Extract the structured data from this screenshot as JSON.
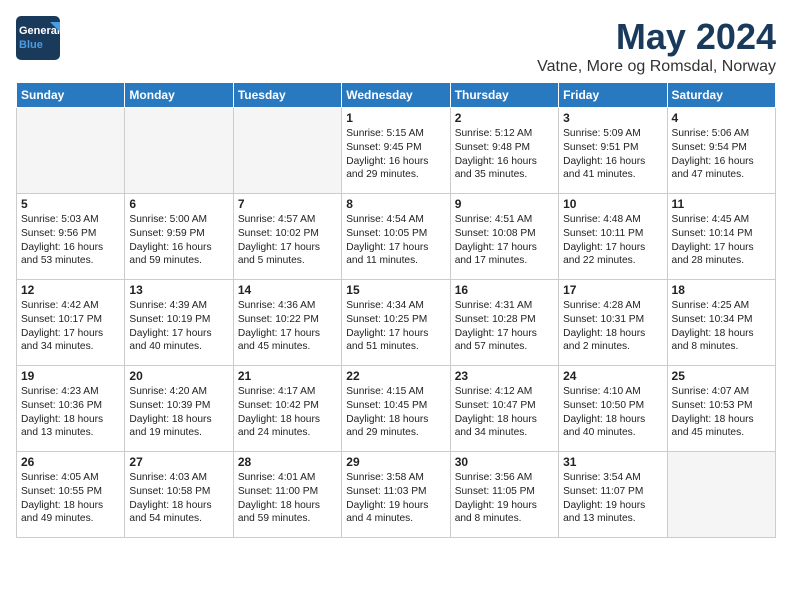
{
  "logo": {
    "line1": "General",
    "line2": "Blue"
  },
  "title": "May 2024",
  "location": "Vatne, More og Romsdal, Norway",
  "headers": [
    "Sunday",
    "Monday",
    "Tuesday",
    "Wednesday",
    "Thursday",
    "Friday",
    "Saturday"
  ],
  "weeks": [
    [
      {
        "day": "",
        "content": ""
      },
      {
        "day": "",
        "content": ""
      },
      {
        "day": "",
        "content": ""
      },
      {
        "day": "1",
        "content": "Sunrise: 5:15 AM\nSunset: 9:45 PM\nDaylight: 16 hours\nand 29 minutes."
      },
      {
        "day": "2",
        "content": "Sunrise: 5:12 AM\nSunset: 9:48 PM\nDaylight: 16 hours\nand 35 minutes."
      },
      {
        "day": "3",
        "content": "Sunrise: 5:09 AM\nSunset: 9:51 PM\nDaylight: 16 hours\nand 41 minutes."
      },
      {
        "day": "4",
        "content": "Sunrise: 5:06 AM\nSunset: 9:54 PM\nDaylight: 16 hours\nand 47 minutes."
      }
    ],
    [
      {
        "day": "5",
        "content": "Sunrise: 5:03 AM\nSunset: 9:56 PM\nDaylight: 16 hours\nand 53 minutes."
      },
      {
        "day": "6",
        "content": "Sunrise: 5:00 AM\nSunset: 9:59 PM\nDaylight: 16 hours\nand 59 minutes."
      },
      {
        "day": "7",
        "content": "Sunrise: 4:57 AM\nSunset: 10:02 PM\nDaylight: 17 hours\nand 5 minutes."
      },
      {
        "day": "8",
        "content": "Sunrise: 4:54 AM\nSunset: 10:05 PM\nDaylight: 17 hours\nand 11 minutes."
      },
      {
        "day": "9",
        "content": "Sunrise: 4:51 AM\nSunset: 10:08 PM\nDaylight: 17 hours\nand 17 minutes."
      },
      {
        "day": "10",
        "content": "Sunrise: 4:48 AM\nSunset: 10:11 PM\nDaylight: 17 hours\nand 22 minutes."
      },
      {
        "day": "11",
        "content": "Sunrise: 4:45 AM\nSunset: 10:14 PM\nDaylight: 17 hours\nand 28 minutes."
      }
    ],
    [
      {
        "day": "12",
        "content": "Sunrise: 4:42 AM\nSunset: 10:17 PM\nDaylight: 17 hours\nand 34 minutes."
      },
      {
        "day": "13",
        "content": "Sunrise: 4:39 AM\nSunset: 10:19 PM\nDaylight: 17 hours\nand 40 minutes."
      },
      {
        "day": "14",
        "content": "Sunrise: 4:36 AM\nSunset: 10:22 PM\nDaylight: 17 hours\nand 45 minutes."
      },
      {
        "day": "15",
        "content": "Sunrise: 4:34 AM\nSunset: 10:25 PM\nDaylight: 17 hours\nand 51 minutes."
      },
      {
        "day": "16",
        "content": "Sunrise: 4:31 AM\nSunset: 10:28 PM\nDaylight: 17 hours\nand 57 minutes."
      },
      {
        "day": "17",
        "content": "Sunrise: 4:28 AM\nSunset: 10:31 PM\nDaylight: 18 hours\nand 2 minutes."
      },
      {
        "day": "18",
        "content": "Sunrise: 4:25 AM\nSunset: 10:34 PM\nDaylight: 18 hours\nand 8 minutes."
      }
    ],
    [
      {
        "day": "19",
        "content": "Sunrise: 4:23 AM\nSunset: 10:36 PM\nDaylight: 18 hours\nand 13 minutes."
      },
      {
        "day": "20",
        "content": "Sunrise: 4:20 AM\nSunset: 10:39 PM\nDaylight: 18 hours\nand 19 minutes."
      },
      {
        "day": "21",
        "content": "Sunrise: 4:17 AM\nSunset: 10:42 PM\nDaylight: 18 hours\nand 24 minutes."
      },
      {
        "day": "22",
        "content": "Sunrise: 4:15 AM\nSunset: 10:45 PM\nDaylight: 18 hours\nand 29 minutes."
      },
      {
        "day": "23",
        "content": "Sunrise: 4:12 AM\nSunset: 10:47 PM\nDaylight: 18 hours\nand 34 minutes."
      },
      {
        "day": "24",
        "content": "Sunrise: 4:10 AM\nSunset: 10:50 PM\nDaylight: 18 hours\nand 40 minutes."
      },
      {
        "day": "25",
        "content": "Sunrise: 4:07 AM\nSunset: 10:53 PM\nDaylight: 18 hours\nand 45 minutes."
      }
    ],
    [
      {
        "day": "26",
        "content": "Sunrise: 4:05 AM\nSunset: 10:55 PM\nDaylight: 18 hours\nand 49 minutes."
      },
      {
        "day": "27",
        "content": "Sunrise: 4:03 AM\nSunset: 10:58 PM\nDaylight: 18 hours\nand 54 minutes."
      },
      {
        "day": "28",
        "content": "Sunrise: 4:01 AM\nSunset: 11:00 PM\nDaylight: 18 hours\nand 59 minutes."
      },
      {
        "day": "29",
        "content": "Sunrise: 3:58 AM\nSunset: 11:03 PM\nDaylight: 19 hours\nand 4 minutes."
      },
      {
        "day": "30",
        "content": "Sunrise: 3:56 AM\nSunset: 11:05 PM\nDaylight: 19 hours\nand 8 minutes."
      },
      {
        "day": "31",
        "content": "Sunrise: 3:54 AM\nSunset: 11:07 PM\nDaylight: 19 hours\nand 13 minutes."
      },
      {
        "day": "",
        "content": ""
      }
    ]
  ]
}
